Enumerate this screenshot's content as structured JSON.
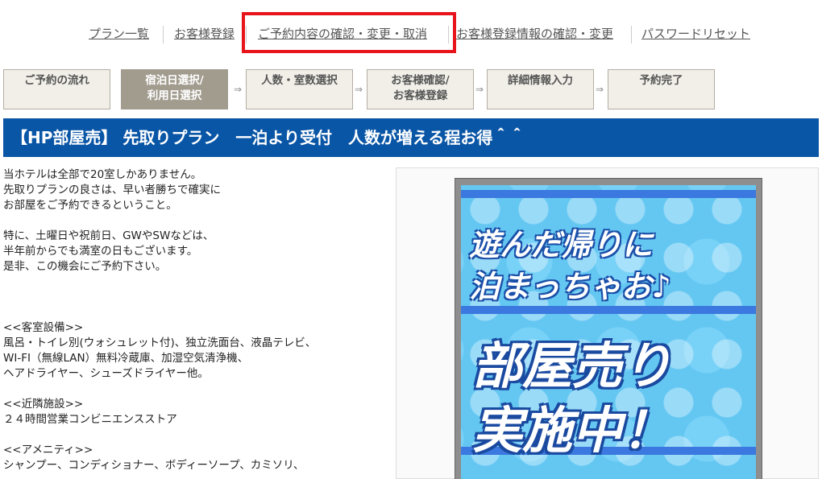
{
  "topnav": {
    "links": [
      {
        "label": "プラン一覧"
      },
      {
        "label": "お客様登録"
      },
      {
        "label": "ご予約内容の確認・変更・取消"
      },
      {
        "label": "お客様登録情報の確認・変更"
      },
      {
        "label": "パスワードリセット"
      }
    ],
    "highlight_color": "#e8141b"
  },
  "steps": [
    {
      "label": "ご予約の流れ"
    },
    {
      "label": "宿泊日選択/\n利用日選択"
    },
    {
      "label": "人数・室数選択"
    },
    {
      "label": "お客様確認/\nお客様登録"
    },
    {
      "label": "詳細情報入力"
    },
    {
      "label": "予約完了"
    }
  ],
  "step_arrow": "⇒",
  "plan": {
    "title": "【HP部屋売】 先取りプラン　一泊より受付　人数が増える程お得＾＾",
    "band_color": "#0a56a6",
    "paragraphs": [
      "当ホテルは全部で20室しかありません。\n先取りプランの良さは、早い者勝ちで確実に\nお部屋をご予約できるということ。",
      "特に、土曜日や祝前日、GWやSWなどは、\n半年前からでも満室の日もございます。\n是非、この機会にご予約下さい。",
      "<<客室設備>>\n風呂・トイレ別(ウォシュレット付)、独立洗面台、液晶テレビ、\nWI-FI（無線LAN）無料冷蔵庫、加湿空気清浄機、\nヘアドライヤー、シューズドライヤー他。",
      "<<近隣施設>>\n２４時間営業コンビニエンスストア",
      "<<アメニティ>>\nシャンプー、コンディショナー、ボディーソープ、カミソリ、"
    ]
  },
  "poster": {
    "line1": "遊んだ帰りに\n泊まっちゃお♪",
    "line2": "部屋売り\n実施中！"
  }
}
